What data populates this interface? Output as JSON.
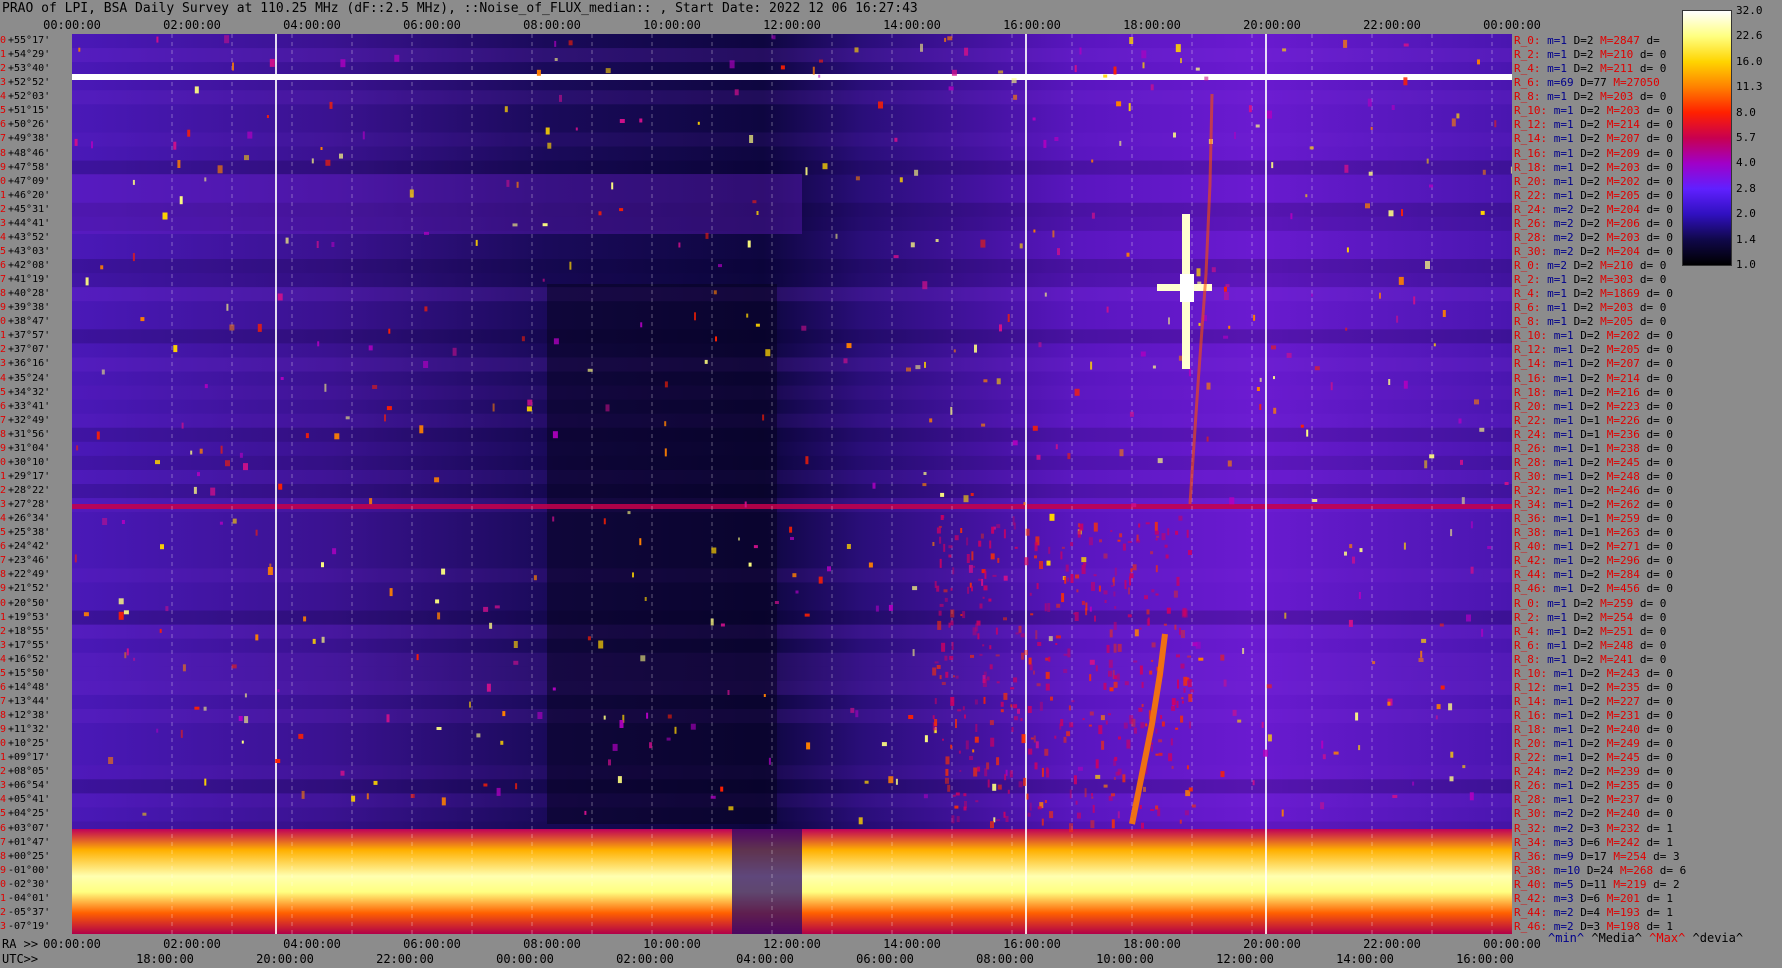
{
  "header": {
    "title": "PRAO of LPI, BSA Daily Survey at 110.25 MHz (dF::2.5 MHz), ::Noise_of_FLUX_median:: , Start Date: 2022 12 06 16:27:43"
  },
  "axes": {
    "top_time_labels": [
      "00:00:00",
      "02:00:00",
      "04:00:00",
      "06:00:00",
      "08:00:00",
      "10:00:00",
      "12:00:00",
      "14:00:00",
      "16:00:00",
      "18:00:00",
      "20:00:00",
      "22:00:00",
      "00:00:00"
    ],
    "ra_prefix": "RA >>",
    "ra_labels": [
      "00:00:00",
      "02:00:00",
      "04:00:00",
      "06:00:00",
      "08:00:00",
      "10:00:00",
      "12:00:00",
      "14:00:00",
      "16:00:00",
      "18:00:00",
      "20:00:00",
      "22:00:00",
      "00:00:00"
    ],
    "utc_prefix": "UTC>>",
    "utc_labels": [
      "18:00:00",
      "20:00:00",
      "22:00:00",
      "00:00:00",
      "02:00:00",
      "04:00:00",
      "06:00:00",
      "08:00:00",
      "10:00:00",
      "12:00:00",
      "14:00:00",
      "16:00:00"
    ]
  },
  "declinations": [
    {
      "i": "0",
      "d": "+55°17'"
    },
    {
      "i": "1",
      "d": "+54°29'"
    },
    {
      "i": "2",
      "d": "+53°40'"
    },
    {
      "i": "3",
      "d": "+52°52'"
    },
    {
      "i": "4",
      "d": "+52°03'"
    },
    {
      "i": "5",
      "d": "+51°15'"
    },
    {
      "i": "6",
      "d": "+50°26'"
    },
    {
      "i": "7",
      "d": "+49°38'"
    },
    {
      "i": "8",
      "d": "+48°46'"
    },
    {
      "i": "9",
      "d": "+47°58'"
    },
    {
      "i": "10",
      "d": "+47°09'"
    },
    {
      "i": "11",
      "d": "+46°20'"
    },
    {
      "i": "12",
      "d": "+45°31'"
    },
    {
      "i": "13",
      "d": "+44°41'"
    },
    {
      "i": "14",
      "d": "+43°52'"
    },
    {
      "i": "15",
      "d": "+43°03'"
    },
    {
      "i": "16",
      "d": "+42°08'"
    },
    {
      "i": "17",
      "d": "+41°19'"
    },
    {
      "i": "18",
      "d": "+40°28'"
    },
    {
      "i": "19",
      "d": "+39°38'"
    },
    {
      "i": "20",
      "d": "+38°47'"
    },
    {
      "i": "21",
      "d": "+37°57'"
    },
    {
      "i": "22",
      "d": "+37°07'"
    },
    {
      "i": "23",
      "d": "+36°16'"
    },
    {
      "i": "24",
      "d": "+35°24'"
    },
    {
      "i": "25",
      "d": "+34°32'"
    },
    {
      "i": "26",
      "d": "+33°41'"
    },
    {
      "i": "27",
      "d": "+32°49'"
    },
    {
      "i": "28",
      "d": "+31°56'"
    },
    {
      "i": "29",
      "d": "+31°04'"
    },
    {
      "i": "30",
      "d": "+30°10'"
    },
    {
      "i": "31",
      "d": "+29°17'"
    },
    {
      "i": "32",
      "d": "+28°22'"
    },
    {
      "i": "33",
      "d": "+27°28'"
    },
    {
      "i": "34",
      "d": "+26°34'"
    },
    {
      "i": "35",
      "d": "+25°38'"
    },
    {
      "i": "36",
      "d": "+24°42'"
    },
    {
      "i": "37",
      "d": "+23°46'"
    },
    {
      "i": "38",
      "d": "+22°49'"
    },
    {
      "i": "39",
      "d": "+21°52'"
    },
    {
      "i": "40",
      "d": "+20°50'"
    },
    {
      "i": "41",
      "d": "+19°53'"
    },
    {
      "i": "42",
      "d": "+18°55'"
    },
    {
      "i": "43",
      "d": "+17°55'"
    },
    {
      "i": "44",
      "d": "+16°52'"
    },
    {
      "i": "45",
      "d": "+15°50'"
    },
    {
      "i": "46",
      "d": "+14°48'"
    },
    {
      "i": "47",
      "d": "+13°44'"
    },
    {
      "i": "48",
      "d": "+12°38'"
    },
    {
      "i": "49",
      "d": "+11°32'"
    },
    {
      "i": "50",
      "d": "+10°25'"
    },
    {
      "i": "51",
      "d": "+09°17'"
    },
    {
      "i": "52",
      "d": "+08°05'"
    },
    {
      "i": "53",
      "d": "+06°54'"
    },
    {
      "i": "54",
      "d": "+05°41'"
    },
    {
      "i": "55",
      "d": "+04°25'"
    },
    {
      "i": "56",
      "d": "+03°07'"
    },
    {
      "i": "57",
      "d": "+01°47'"
    },
    {
      "i": "58",
      "d": "+00°25'"
    },
    {
      "i": "59",
      "d": "-01°00'"
    },
    {
      "i": "60",
      "d": "-02°30'"
    },
    {
      "i": "61",
      "d": "-04°01'"
    },
    {
      "i": "62",
      "d": "-05°37'"
    },
    {
      "i": "63",
      "d": "-07°19'"
    }
  ],
  "stats": [
    {
      "r": "R_0:",
      "m": "m=1",
      "D": "D=2",
      "M": "M=2847",
      "d": "d="
    },
    {
      "r": "R_2:",
      "m": "m=1",
      "D": "D=2",
      "M": "M=210",
      "d": "d= 0"
    },
    {
      "r": "R_4:",
      "m": "m=1",
      "D": "D=2",
      "M": "M=211",
      "d": "d= 0"
    },
    {
      "r": "R_6:",
      "m": "m=69",
      "D": "D=77",
      "M": "M=27050",
      "d": ""
    },
    {
      "r": "R_8:",
      "m": "m=1",
      "D": "D=2",
      "M": "M=203",
      "d": "d= 0"
    },
    {
      "r": "R_10:",
      "m": "m=1",
      "D": "D=2",
      "M": "M=203",
      "d": "d= 0"
    },
    {
      "r": "R_12:",
      "m": "m=1",
      "D": "D=2",
      "M": "M=214",
      "d": "d= 0"
    },
    {
      "r": "R_14:",
      "m": "m=1",
      "D": "D=2",
      "M": "M=207",
      "d": "d= 0"
    },
    {
      "r": "R_16:",
      "m": "m=1",
      "D": "D=2",
      "M": "M=209",
      "d": "d= 0"
    },
    {
      "r": "R_18:",
      "m": "m=1",
      "D": "D=2",
      "M": "M=203",
      "d": "d= 0"
    },
    {
      "r": "R_20:",
      "m": "m=1",
      "D": "D=2",
      "M": "M=202",
      "d": "d= 0"
    },
    {
      "r": "R_22:",
      "m": "m=1",
      "D": "D=2",
      "M": "M=205",
      "d": "d= 0"
    },
    {
      "r": "R_24:",
      "m": "m=2",
      "D": "D=2",
      "M": "M=204",
      "d": "d= 0"
    },
    {
      "r": "R_26:",
      "m": "m=2",
      "D": "D=2",
      "M": "M=206",
      "d": "d= 0"
    },
    {
      "r": "R_28:",
      "m": "m=2",
      "D": "D=2",
      "M": "M=203",
      "d": "d= 0"
    },
    {
      "r": "R_30:",
      "m": "m=2",
      "D": "D=2",
      "M": "M=204",
      "d": "d= 0"
    },
    {
      "r": "R_0:",
      "m": "m=2",
      "D": "D=2",
      "M": "M=210",
      "d": "d= 0"
    },
    {
      "r": "R_2:",
      "m": "m=1",
      "D": "D=2",
      "M": "M=303",
      "d": "d= 0"
    },
    {
      "r": "R_4:",
      "m": "m=1",
      "D": "D=2",
      "M": "M=1869",
      "d": "d= 0"
    },
    {
      "r": "R_6:",
      "m": "m=1",
      "D": "D=2",
      "M": "M=203",
      "d": "d= 0"
    },
    {
      "r": "R_8:",
      "m": "m=1",
      "D": "D=2",
      "M": "M=205",
      "d": "d= 0"
    },
    {
      "r": "R_10:",
      "m": "m=1",
      "D": "D=2",
      "M": "M=202",
      "d": "d= 0"
    },
    {
      "r": "R_12:",
      "m": "m=1",
      "D": "D=2",
      "M": "M=205",
      "d": "d= 0"
    },
    {
      "r": "R_14:",
      "m": "m=1",
      "D": "D=2",
      "M": "M=207",
      "d": "d= 0"
    },
    {
      "r": "R_16:",
      "m": "m=1",
      "D": "D=2",
      "M": "M=214",
      "d": "d= 0"
    },
    {
      "r": "R_18:",
      "m": "m=1",
      "D": "D=2",
      "M": "M=216",
      "d": "d= 0"
    },
    {
      "r": "R_20:",
      "m": "m=1",
      "D": "D=2",
      "M": "M=223",
      "d": "d= 0"
    },
    {
      "r": "R_22:",
      "m": "m=1",
      "D": "D=1",
      "M": "M=226",
      "d": "d= 0"
    },
    {
      "r": "R_24:",
      "m": "m=1",
      "D": "D=1",
      "M": "M=236",
      "d": "d= 0"
    },
    {
      "r": "R_26:",
      "m": "m=1",
      "D": "D=1",
      "M": "M=238",
      "d": "d= 0"
    },
    {
      "r": "R_28:",
      "m": "m=1",
      "D": "D=2",
      "M": "M=245",
      "d": "d= 0"
    },
    {
      "r": "R_30:",
      "m": "m=1",
      "D": "D=2",
      "M": "M=248",
      "d": "d= 0"
    },
    {
      "r": "R_32:",
      "m": "m=1",
      "D": "D=2",
      "M": "M=246",
      "d": "d= 0"
    },
    {
      "r": "R_34:",
      "m": "m=1",
      "D": "D=2",
      "M": "M=262",
      "d": "d= 0"
    },
    {
      "r": "R_36:",
      "m": "m=1",
      "D": "D=1",
      "M": "M=259",
      "d": "d= 0"
    },
    {
      "r": "R_38:",
      "m": "m=1",
      "D": "D=1",
      "M": "M=263",
      "d": "d= 0"
    },
    {
      "r": "R_40:",
      "m": "m=1",
      "D": "D=2",
      "M": "M=271",
      "d": "d= 0"
    },
    {
      "r": "R_42:",
      "m": "m=1",
      "D": "D=2",
      "M": "M=296",
      "d": "d= 0"
    },
    {
      "r": "R_44:",
      "m": "m=1",
      "D": "D=2",
      "M": "M=284",
      "d": "d= 0"
    },
    {
      "r": "R_46:",
      "m": "m=1",
      "D": "D=2",
      "M": "M=456",
      "d": "d= 0"
    },
    {
      "r": "R_0:",
      "m": "m=1",
      "D": "D=2",
      "M": "M=259",
      "d": "d= 0"
    },
    {
      "r": "R_2:",
      "m": "m=1",
      "D": "D=2",
      "M": "M=254",
      "d": "d= 0"
    },
    {
      "r": "R_4:",
      "m": "m=1",
      "D": "D=2",
      "M": "M=251",
      "d": "d= 0"
    },
    {
      "r": "R_6:",
      "m": "m=1",
      "D": "D=2",
      "M": "M=248",
      "d": "d= 0"
    },
    {
      "r": "R_8:",
      "m": "m=1",
      "D": "D=2",
      "M": "M=241",
      "d": "d= 0"
    },
    {
      "r": "R_10:",
      "m": "m=1",
      "D": "D=2",
      "M": "M=243",
      "d": "d= 0"
    },
    {
      "r": "R_12:",
      "m": "m=1",
      "D": "D=2",
      "M": "M=235",
      "d": "d= 0"
    },
    {
      "r": "R_14:",
      "m": "m=1",
      "D": "D=2",
      "M": "M=227",
      "d": "d= 0"
    },
    {
      "r": "R_16:",
      "m": "m=1",
      "D": "D=2",
      "M": "M=231",
      "d": "d= 0"
    },
    {
      "r": "R_18:",
      "m": "m=1",
      "D": "D=2",
      "M": "M=240",
      "d": "d= 0"
    },
    {
      "r": "R_20:",
      "m": "m=1",
      "D": "D=2",
      "M": "M=249",
      "d": "d= 0"
    },
    {
      "r": "R_22:",
      "m": "m=1",
      "D": "D=2",
      "M": "M=245",
      "d": "d= 0"
    },
    {
      "r": "R_24:",
      "m": "m=2",
      "D": "D=2",
      "M": "M=239",
      "d": "d= 0"
    },
    {
      "r": "R_26:",
      "m": "m=1",
      "D": "D=2",
      "M": "M=235",
      "d": "d= 0"
    },
    {
      "r": "R_28:",
      "m": "m=1",
      "D": "D=2",
      "M": "M=237",
      "d": "d= 0"
    },
    {
      "r": "R_30:",
      "m": "m=2",
      "D": "D=2",
      "M": "M=240",
      "d": "d= 0"
    },
    {
      "r": "R_32:",
      "m": "m=2",
      "D": "D=3",
      "M": "M=232",
      "d": "d= 1"
    },
    {
      "r": "R_34:",
      "m": "m=3",
      "D": "D=6",
      "M": "M=242",
      "d": "d= 1"
    },
    {
      "r": "R_36:",
      "m": "m=9",
      "D": "D=17",
      "M": "M=254",
      "d": "d= 3"
    },
    {
      "r": "R_38:",
      "m": "m=10",
      "D": "D=24",
      "M": "M=268",
      "d": "d= 6"
    },
    {
      "r": "R_40:",
      "m": "m=5",
      "D": "D=11",
      "M": "M=219",
      "d": "d= 2"
    },
    {
      "r": "R_42:",
      "m": "m=3",
      "D": "D=6",
      "M": "M=201",
      "d": "d= 1"
    },
    {
      "r": "R_44:",
      "m": "m=2",
      "D": "D=4",
      "M": "M=193",
      "d": "d= 1"
    },
    {
      "r": "R_46:",
      "m": "m=2",
      "D": "D=3",
      "M": "M=198",
      "d": "d= 1"
    }
  ],
  "legend_caption": {
    "min": "^min^",
    "media": "^Media^",
    "max": "^Max^",
    "devia": "^devia^"
  },
  "colorbar": {
    "labels": [
      "32.0",
      "22.6",
      "16.0",
      "11.3",
      "8.0",
      "5.7",
      "4.0",
      "2.8",
      "2.0",
      "1.4",
      "1.0"
    ],
    "stops": [
      "#ffffff",
      "#ffff80",
      "#ffd400",
      "#ff8000",
      "#ff2000",
      "#c80050",
      "#a000c8",
      "#6020ff",
      "#3010c0",
      "#10084a",
      "#000000"
    ]
  },
  "chart_data": {
    "type": "heatmap",
    "title": "PRAO of LPI, BSA Daily Survey at 110.25 MHz (dF::2.5 MHz), ::Noise_of_FLUX_median:: , Start Date: 2022 12 06 16:27:43",
    "x_unit": "RA (hh:mm:ss)",
    "x_range": [
      "00:00:00",
      "24:00:00"
    ],
    "y_categories_count": 64,
    "y_range_deg": [
      "+55°17'",
      "-07°19'"
    ],
    "color_scale_range": [
      1.0,
      32.0
    ],
    "features": [
      {
        "desc": "saturated horizontal band",
        "rows": "3",
        "ra_range": [
          "00:00",
          "24:00"
        ],
        "level": 32.0
      },
      {
        "desc": "bright galactic-plane band",
        "rows": "57-63",
        "ra_range": [
          "00:00",
          "24:00"
        ],
        "level": 22.6
      },
      {
        "desc": "bright radio source cross",
        "row": "17",
        "ra": "20:00",
        "level": 32.0
      },
      {
        "desc": "horizontal interference line",
        "row": "35",
        "ra_range": [
          "00:00",
          "24:00"
        ],
        "level": 5.7
      },
      {
        "desc": "low-noise dark region",
        "rows": "20-56",
        "ra_range": [
          "08:00",
          "13:00"
        ],
        "level": 1.4
      }
    ]
  }
}
